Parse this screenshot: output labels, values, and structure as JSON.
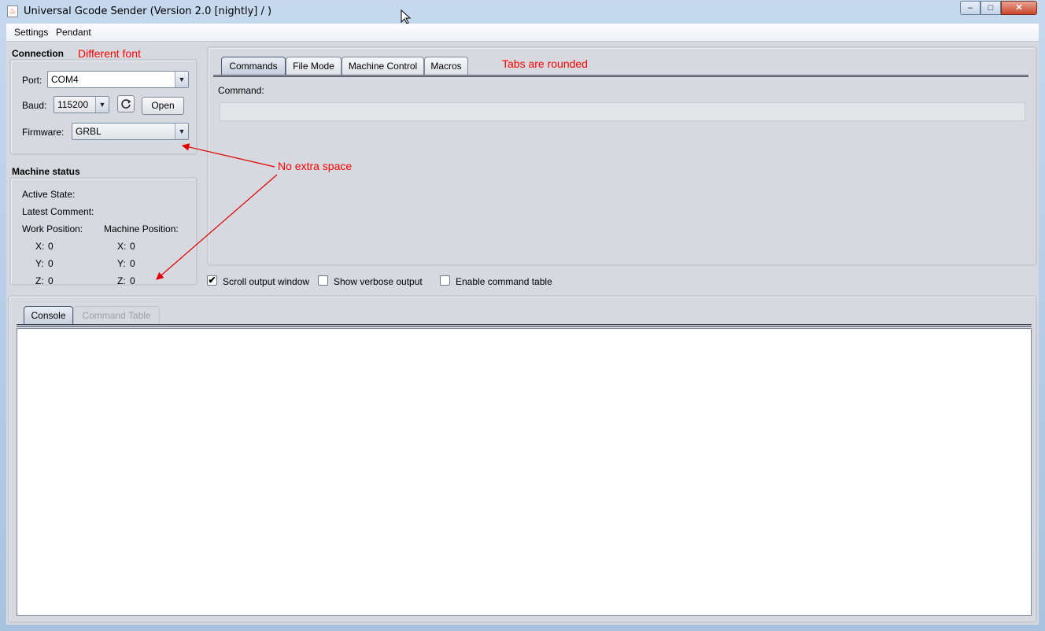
{
  "window": {
    "title": "Universal Gcode Sender (Version 2.0 [nightly]  / )",
    "icon_name": "java-cup-icon",
    "minimize_glyph": "–",
    "maximize_glyph": "□",
    "close_glyph": "✕"
  },
  "menu": {
    "items": [
      "Settings",
      "Pendant"
    ]
  },
  "connection": {
    "title": "Connection",
    "port_label": "Port:",
    "port_value": "COM4",
    "baud_label": "Baud:",
    "baud_value": "115200",
    "refresh_icon": "refresh-icon",
    "open_label": "Open",
    "firmware_label": "Firmware:",
    "firmware_value": "GRBL"
  },
  "machine_status": {
    "title": "Machine status",
    "active_state_label": "Active State:",
    "latest_comment_label": "Latest Comment:",
    "work_position_label": "Work Position:",
    "machine_position_label": "Machine Position:",
    "work": {
      "x_label": "X:",
      "x": "0",
      "y_label": "Y:",
      "y": "0",
      "z_label": "Z:",
      "z": "0"
    },
    "machine": {
      "x_label": "X:",
      "x": "0",
      "y_label": "Y:",
      "y": "0",
      "z_label": "Z:",
      "z": "0"
    }
  },
  "top_tabs": {
    "items": [
      "Commands",
      "File Mode",
      "Machine Control",
      "Macros"
    ],
    "active": "Commands"
  },
  "commands": {
    "command_label": "Command:",
    "command_value": ""
  },
  "options": {
    "scroll_output": {
      "label": "Scroll output window",
      "checked": true
    },
    "verbose_output": {
      "label": "Show verbose output",
      "checked": false
    },
    "command_table": {
      "label": "Enable command table",
      "checked": false
    },
    "check_glyph": "✔"
  },
  "bottom_tabs": {
    "items": [
      "Console",
      "Command Table"
    ],
    "active": "Console"
  },
  "console": {
    "text": ""
  },
  "annotations": {
    "font": "Different font",
    "tabs": "Tabs are rounded",
    "space": "No extra space",
    "color": "#ff0000"
  }
}
